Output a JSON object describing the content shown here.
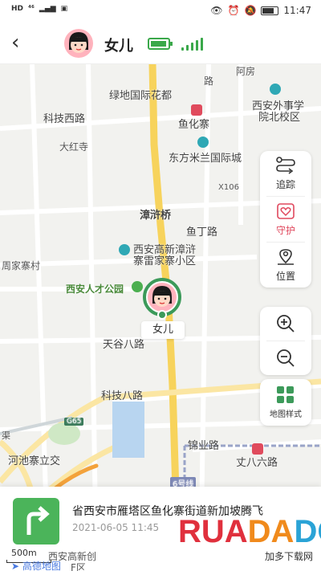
{
  "status_bar": {
    "left_icons": [
      "hd-icon",
      "4g-icon",
      "signal-icon",
      "app-icon"
    ],
    "time": "11:47"
  },
  "header": {
    "title": "女儿",
    "battery_level": 0.8,
    "signal_bars": 5,
    "accent": "#3aa84a"
  },
  "map": {
    "labels": {
      "lvdi": "绿地国际花都",
      "keji_west": "科技西路",
      "dahongsi": "大红寺",
      "yuhuazhai": "鱼化寨",
      "dongfang": "东方米兰国际城",
      "waishi": "西安外事学",
      "waishi2": "院北校区",
      "afang": "阿房",
      "afang2": "路",
      "x106": "X106",
      "zhanghuqiao": "漳浒桥",
      "yuding": "鱼丁路",
      "gaoxin": "西安高新漳浒",
      "gaoxin2": "寨雷家寨小区",
      "zhoujia": "周家寨村",
      "rencai": "西安人才公园",
      "tiangu": "天谷八路",
      "keji8": "科技八路",
      "g65": "G65",
      "hechi": "河池寨立交",
      "jinye": "锦业路",
      "zhangba6": "丈八六路",
      "line6": "6号线",
      "zhang": "丈",
      "qu": "渠"
    },
    "pin_label": "女儿"
  },
  "panel": {
    "track": "追踪",
    "guard": "守护",
    "location": "位置",
    "zoom_in": "+",
    "zoom_out": "−",
    "map_style": "地图样式"
  },
  "card": {
    "address": "省西安市雁塔区鱼化寨街道新加坡腾飞",
    "time": "2021-06-05 11:45",
    "scale": "500m",
    "map_source": "高德地图",
    "bottom_road": "西安高新创",
    "bottom_road2": "F区"
  },
  "watermark": {
    "text": "RUANDADO",
    "sub": "加多下载网"
  }
}
